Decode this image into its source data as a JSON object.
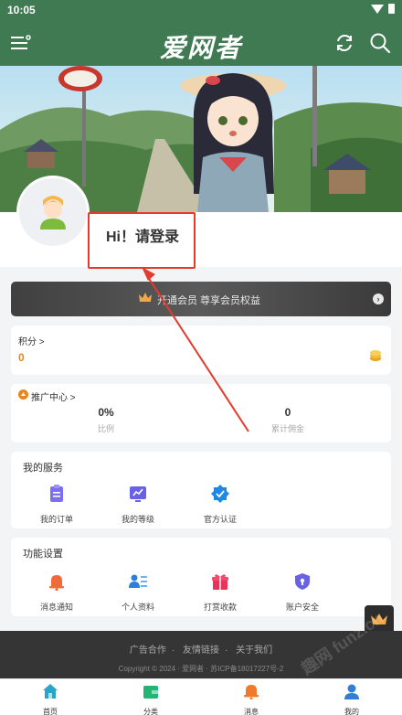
{
  "status": {
    "time": "10:05"
  },
  "app": {
    "title": "爱网者"
  },
  "profile": {
    "login_text": "Hi！请登录"
  },
  "vip": {
    "label": "开通会员 尊享会员权益"
  },
  "points": {
    "label": "积分 >",
    "value": "0"
  },
  "promotion": {
    "label": "推广中心 >",
    "ratio_value": "0%",
    "ratio_label": "比例",
    "commission_value": "0",
    "commission_label": "累计佣金"
  },
  "services": {
    "title": "我的服务",
    "items": [
      {
        "label": "我的订单",
        "icon": "clipboard-icon"
      },
      {
        "label": "我的等级",
        "icon": "chart-icon"
      },
      {
        "label": "官方认证",
        "icon": "verified-icon"
      }
    ]
  },
  "settings": {
    "title": "功能设置",
    "items": [
      {
        "label": "消息通知",
        "icon": "bell-icon"
      },
      {
        "label": "个人资料",
        "icon": "profile-card-icon"
      },
      {
        "label": "打赏收款",
        "icon": "gift-icon"
      },
      {
        "label": "账户安全",
        "icon": "shield-icon"
      }
    ]
  },
  "footer": {
    "links": [
      "广告合作",
      "友情链接",
      "关于我们"
    ],
    "copyright": "Copyright © 2024 · 爱网者 · 苏ICP备18017227号-2"
  },
  "tabs": [
    {
      "label": "首页",
      "icon": "home-icon"
    },
    {
      "label": "分类",
      "icon": "wallet-icon"
    },
    {
      "label": "消息",
      "icon": "bell-icon"
    },
    {
      "label": "我的",
      "icon": "user-icon"
    }
  ],
  "watermark": "趣网 funz.cn",
  "colors": {
    "primary": "#3f7a52",
    "accent": "#e8861a",
    "annotation": "#e53b2d",
    "blue": "#1e88e5"
  }
}
